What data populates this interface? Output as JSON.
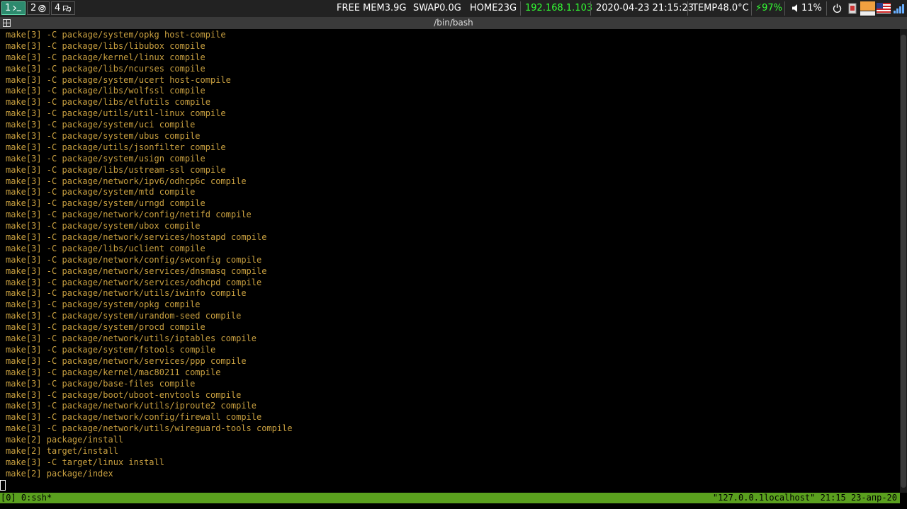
{
  "topbar": {
    "workspaces": [
      {
        "num": "1",
        "icon": "terminal-icon",
        "active": true
      },
      {
        "num": "2",
        "icon": "browser-icon",
        "active": false
      },
      {
        "num": "4",
        "icon": "chat-icon",
        "active": false
      }
    ],
    "free_mem": "FREE MEM3.9G",
    "swap": "SWAP0.0G",
    "home": "HOME23G",
    "ip": "192.168.1.103",
    "datetime": "2020-04-23 21:15:23",
    "temp": "TEMP48.0°C",
    "battery": "⚡97%",
    "volume": "11%",
    "accent_color": "#2d8a6e",
    "ip_color": "#33ff33"
  },
  "window": {
    "title": "/bin/bash"
  },
  "terminal": {
    "text_color": "#c9a040",
    "lines": [
      "make[3] -C package/system/opkg host-compile",
      "make[3] -C package/libs/libubox compile",
      "make[3] -C package/kernel/linux compile",
      "make[3] -C package/libs/ncurses compile",
      "make[3] -C package/system/ucert host-compile",
      "make[3] -C package/libs/wolfssl compile",
      "make[3] -C package/libs/elfutils compile",
      "make[3] -C package/utils/util-linux compile",
      "make[3] -C package/system/uci compile",
      "make[3] -C package/system/ubus compile",
      "make[3] -C package/utils/jsonfilter compile",
      "make[3] -C package/system/usign compile",
      "make[3] -C package/libs/ustream-ssl compile",
      "make[3] -C package/network/ipv6/odhcp6c compile",
      "make[3] -C package/system/mtd compile",
      "make[3] -C package/system/urngd compile",
      "make[3] -C package/network/config/netifd compile",
      "make[3] -C package/system/ubox compile",
      "make[3] -C package/network/services/hostapd compile",
      "make[3] -C package/libs/uclient compile",
      "make[3] -C package/network/config/swconfig compile",
      "make[3] -C package/network/services/dnsmasq compile",
      "make[3] -C package/network/services/odhcpd compile",
      "make[3] -C package/network/utils/iwinfo compile",
      "make[3] -C package/system/opkg compile",
      "make[3] -C package/system/urandom-seed compile",
      "make[3] -C package/system/procd compile",
      "make[3] -C package/network/utils/iptables compile",
      "make[3] -C package/system/fstools compile",
      "make[3] -C package/network/services/ppp compile",
      "make[3] -C package/kernel/mac80211 compile",
      "make[3] -C package/base-files compile",
      "make[3] -C package/boot/uboot-envtools compile",
      "make[3] -C package/network/utils/iproute2 compile",
      "make[3] -C package/network/config/firewall compile",
      "make[3] -C package/network/utils/wireguard-tools compile",
      "make[2] package/install",
      "make[2] target/install",
      "make[3] -C target/linux install",
      "make[2] package/index"
    ]
  },
  "tmux": {
    "left": "[0] 0:ssh*",
    "right": "\"127.0.0.1localhost\" 21:15 23-апр-20",
    "bg_color": "#5aa01e"
  }
}
